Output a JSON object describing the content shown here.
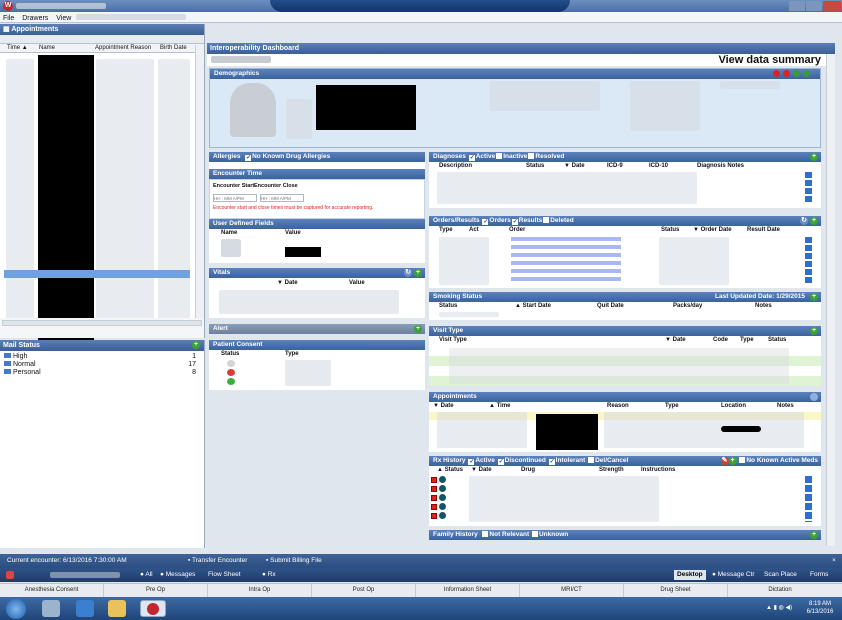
{
  "window": {
    "title": "Myers, Malcolm",
    "app_logo": "W"
  },
  "menu": {
    "items": [
      "File",
      "Drawers",
      "View"
    ]
  },
  "appointments": {
    "title": "Appointments",
    "columns": [
      "Time ▲",
      "Name",
      "Appointment Reason",
      "Birth Date"
    ]
  },
  "mail_status": {
    "title": "Mail Status",
    "items": [
      {
        "label": "High",
        "count": "1"
      },
      {
        "label": "Normal",
        "count": "17"
      },
      {
        "label": "Personal",
        "count": "8"
      }
    ]
  },
  "dashboard": {
    "title": "Interoperability Dashboard",
    "patient_name": "Myers, Malcolm",
    "view_summary": "View data summary",
    "demographics_label": "Demographics"
  },
  "allergies": {
    "label": "Allergies",
    "nkda": "No Known Drug Allergies"
  },
  "encounter_time": {
    "label": "Encounter Time",
    "start": "Encounter Start",
    "close": "Encounter Close",
    "start_placeholder": "HH : MM A/PM",
    "close_placeholder": "HH : MM A/PM",
    "warning": "Encounter start and close times must be captured for accurate reporting."
  },
  "user_defined_fields": {
    "label": "User Defined Fields",
    "columns": [
      "Name",
      "Value"
    ]
  },
  "vitals": {
    "label": "Vitals",
    "columns": [
      "▼ Date",
      "Value"
    ]
  },
  "alert": {
    "label": "Alert"
  },
  "patient_consent": {
    "label": "Patient Consent",
    "columns": [
      "Status",
      "Type"
    ]
  },
  "diagnoses": {
    "label": "Diagnoses",
    "filters": [
      "Active",
      "Inactive",
      "Resolved"
    ],
    "columns": [
      "Description",
      "Status",
      "▼ Date",
      "ICD-9",
      "ICD-10",
      "Diagnosis Notes"
    ]
  },
  "orders": {
    "label": "Orders/Results",
    "filters": [
      "Orders",
      "Results",
      "Deleted"
    ],
    "columns": [
      "Type",
      "Act",
      "Order",
      "Status",
      "▼ Order Date",
      "Result Date"
    ]
  },
  "smoking": {
    "label": "Smoking Status",
    "last_updated": "Last Updated Date: 1/29/2015",
    "columns": [
      "Status",
      "▲ Start Date",
      "Quit Date",
      "Packs/day",
      "Notes"
    ]
  },
  "visit_type": {
    "label": "Visit Type",
    "columns": [
      "Visit Type",
      "▼ Date",
      "Code",
      "Type",
      "Status"
    ]
  },
  "appointments_section": {
    "label": "Appointments",
    "columns": [
      "▼ Date",
      "▲ Time",
      "Reason",
      "Type",
      "Location",
      "Notes"
    ]
  },
  "rx_history": {
    "label": "Rx History",
    "filters": [
      "Active",
      "Discontinued",
      "Intolerant",
      "Del/Cancel"
    ],
    "no_known": "No Known Active Meds",
    "columns": [
      "▲ Status",
      "▼ Date",
      "Drug",
      "Strength",
      "Instructions"
    ]
  },
  "family_history": {
    "label": "Family History",
    "filters": [
      "Not Relevant",
      "Unknown"
    ]
  },
  "encounter_bar": {
    "current": "Current encounter: 6/13/2016 7:30:00 AM",
    "transfer": "Transfer Encounter",
    "billing": "Submit Billing File"
  },
  "toolbar": {
    "all": "All",
    "messages": "Messages",
    "flow_sheet": "Flow Sheet",
    "rx": "Rx",
    "desktop": "Desktop",
    "message_ctr": "Message Ctr",
    "scan_place": "Scan Place",
    "forms": "Forms"
  },
  "bottom_tabs": [
    "Anesthesia Consent",
    "Pre Op",
    "Intra Op",
    "Post Op",
    "Information Sheet",
    "MRI/CT",
    "Drug Sheet",
    "Dictation"
  ],
  "clock": {
    "time": "8:19 AM",
    "date": "6/13/2016"
  }
}
